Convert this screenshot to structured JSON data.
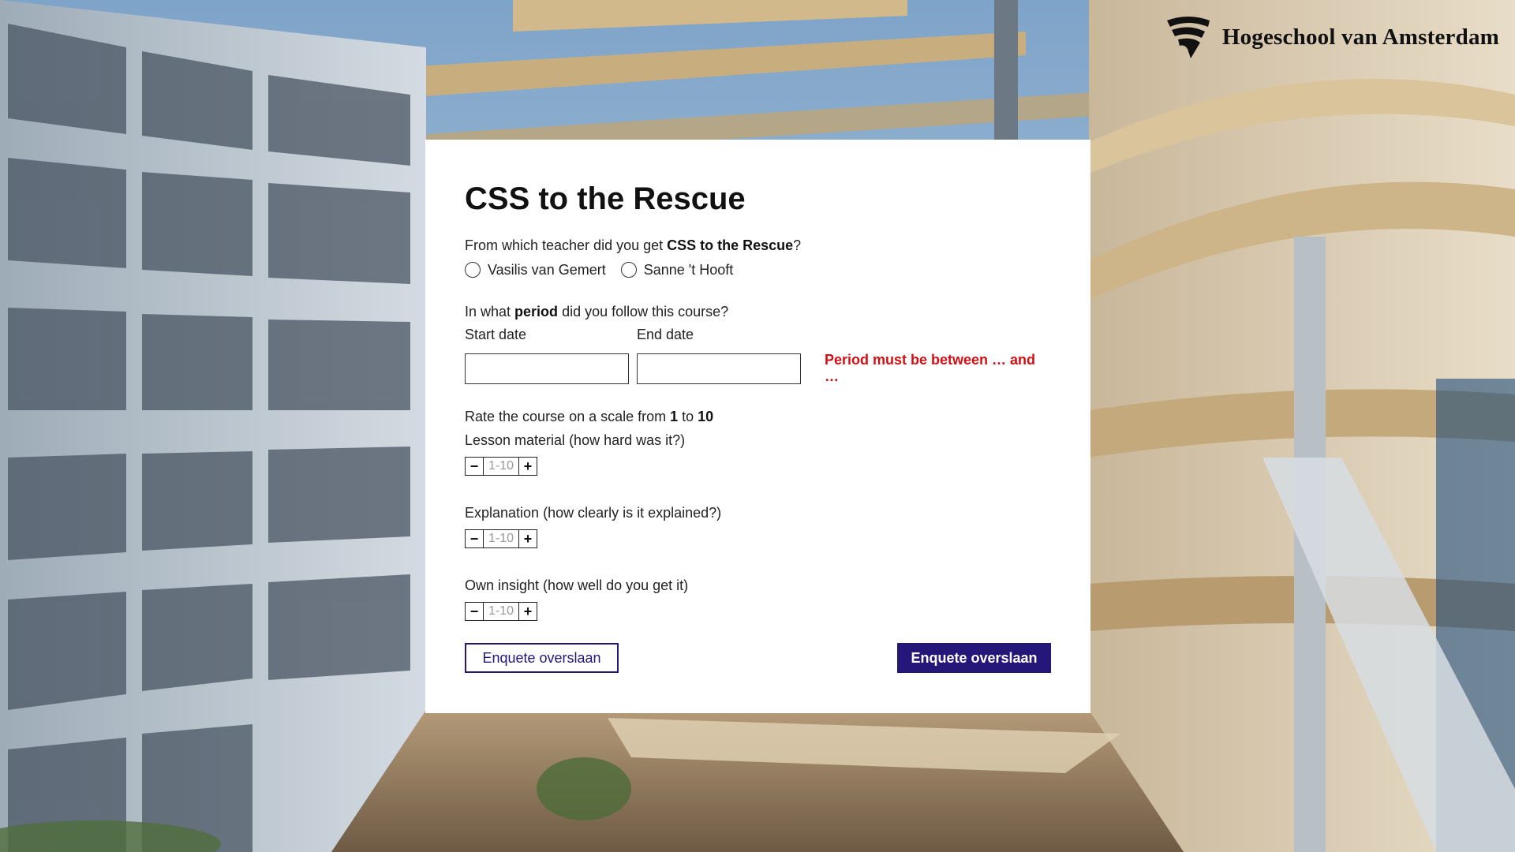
{
  "brand": {
    "logo_text": "Hogeschool van Amsterdam",
    "logo_icon": "hva-logo-icon"
  },
  "form": {
    "title": "CSS to the Rescue",
    "teacher_question": {
      "prefix": "From which teacher did you get ",
      "bold": "CSS to the Rescue",
      "suffix": "?",
      "options": [
        "Vasilis van Gemert",
        "Sanne 't Hooft"
      ]
    },
    "period_question": {
      "prefix": "In what ",
      "bold": "period",
      "suffix": " did you follow this course?",
      "start_label": "Start date",
      "end_label": "End date",
      "start_value": "",
      "end_value": "",
      "error": "Period must be between … and …"
    },
    "rating": {
      "prefix": "Rate the course on a scale from ",
      "min": "1",
      "middle": " to ",
      "max": "10",
      "items": [
        {
          "label": "Lesson material (how hard was it?)",
          "placeholder": "1-10"
        },
        {
          "label": "Explanation (how clearly is it explained?)",
          "placeholder": "1-10"
        },
        {
          "label": "Own insight (how well do you get it)",
          "placeholder": "1-10"
        }
      ],
      "minus": "−",
      "plus": "+"
    },
    "buttons": {
      "secondary": "Enquete overslaan",
      "primary": "Enquete overslaan"
    }
  },
  "colors": {
    "accent": "#25167a",
    "error": "#d40f14"
  }
}
